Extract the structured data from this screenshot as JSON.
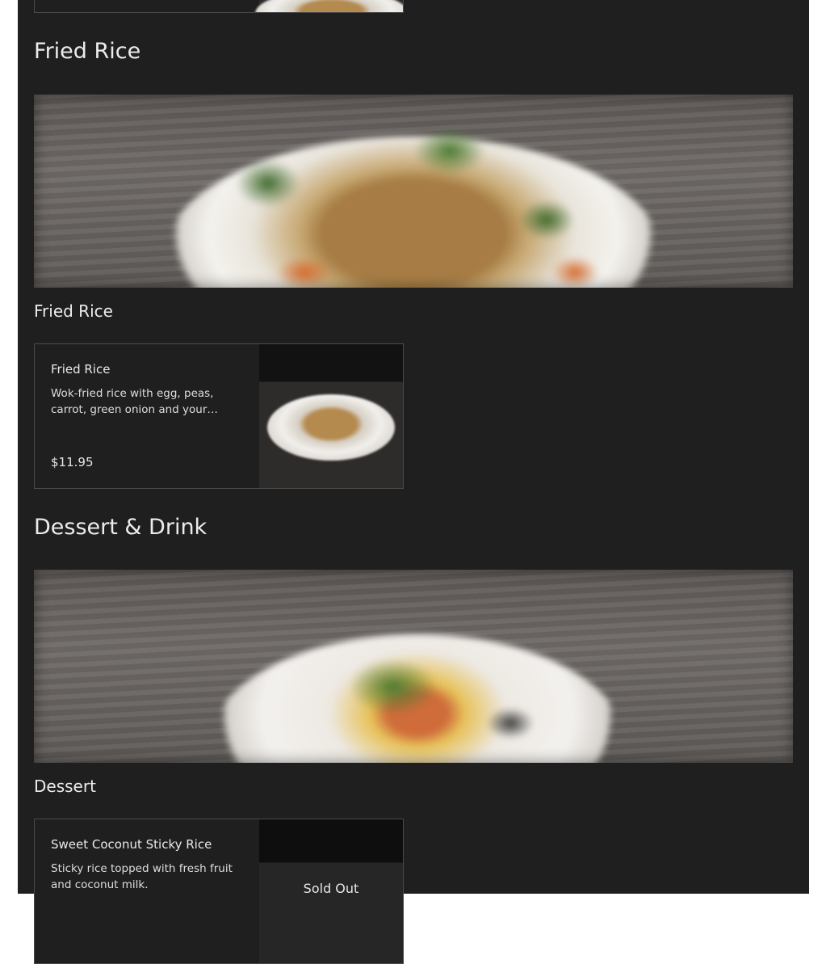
{
  "sections": [
    {
      "title": "Fried Rice",
      "subsection": "Fried Rice",
      "hero_image": "fried-rice-banner",
      "items": [
        {
          "name": "Fried Rice",
          "description": "Wok-fried rice with egg, peas, carrot, green onion and your…",
          "price": "$11.95",
          "image": "fried-rice-thumbnail"
        }
      ]
    },
    {
      "title": "Dessert & Drink",
      "subsection": "Dessert",
      "hero_image": "dessert-banner",
      "items": [
        {
          "name": "Sweet Coconut Sticky Rice",
          "description": "Sticky rice topped with fresh fruit and coconut milk.",
          "status": "Sold Out",
          "image": "sticky-rice-thumbnail"
        }
      ]
    }
  ],
  "colors": {
    "page_background": "#1f1f1f",
    "text": "#e8e8e8",
    "card_border": "#4a4a4a"
  }
}
